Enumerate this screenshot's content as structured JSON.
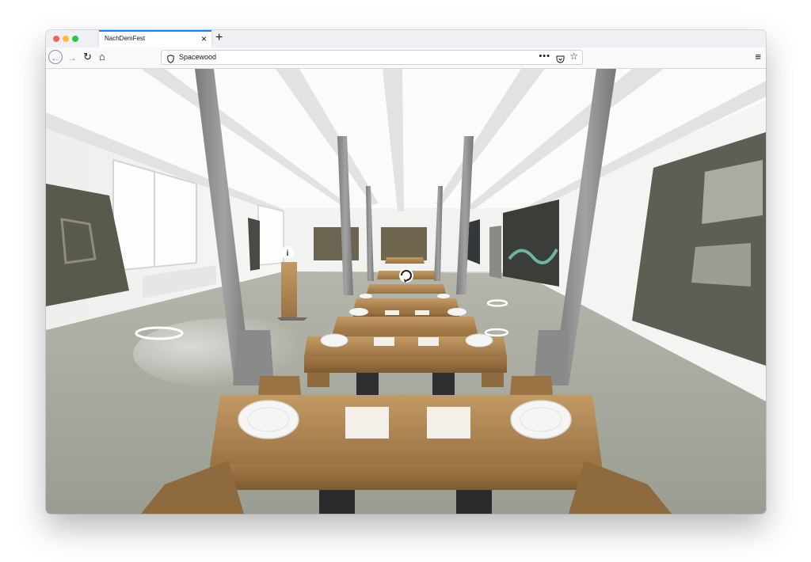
{
  "window": {
    "tabs": [
      {
        "label": "NachDemFest",
        "active": true
      }
    ],
    "new_tab_label": "+"
  },
  "toolbar": {
    "address": "Spacewood",
    "icons": [
      "back-arrow-icon",
      "forward-arrow-icon",
      "reload-icon",
      "home-icon",
      "shield-icon",
      "more-dots-icon",
      "pocket-icon",
      "star-icon",
      "hamburger-menu-icon"
    ]
  },
  "viewer": {
    "hotspots": [
      {
        "kind": "info-hotspot",
        "label": "i"
      },
      {
        "kind": "rotate-hotspot"
      },
      {
        "kind": "floor-nav-hotspot"
      },
      {
        "kind": "floor-nav-hotspot"
      },
      {
        "kind": "floor-nav-hotspot"
      }
    ],
    "colors": {
      "wall": "#f4f4f2",
      "floor": "#a7aa9e",
      "column": "#8c8c8c",
      "wood": "#b08956",
      "ceiling_light": "#ffffff"
    }
  }
}
